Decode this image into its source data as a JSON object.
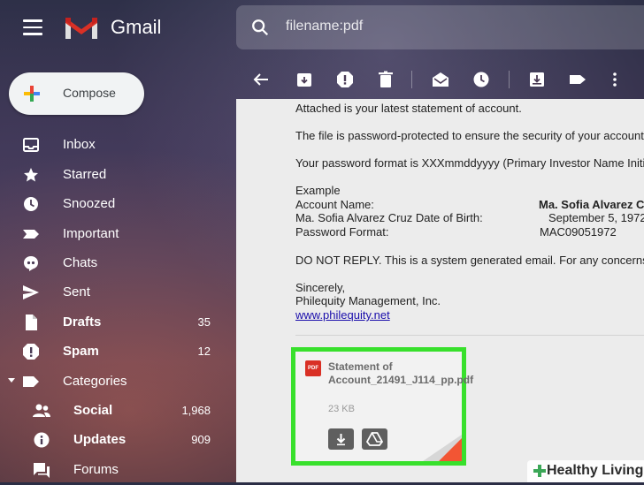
{
  "header": {
    "app_name": "Gmail",
    "search_value": "filename:pdf"
  },
  "compose": {
    "label": "Compose"
  },
  "sidebar": {
    "items": [
      {
        "label": "Inbox",
        "icon": "inbox-icon",
        "bold": false,
        "count": ""
      },
      {
        "label": "Starred",
        "icon": "star-icon",
        "bold": false,
        "count": ""
      },
      {
        "label": "Snoozed",
        "icon": "clock-icon",
        "bold": false,
        "count": ""
      },
      {
        "label": "Important",
        "icon": "important-icon",
        "bold": false,
        "count": ""
      },
      {
        "label": "Chats",
        "icon": "chat-icon",
        "bold": false,
        "count": ""
      },
      {
        "label": "Sent",
        "icon": "send-icon",
        "bold": false,
        "count": ""
      },
      {
        "label": "Drafts",
        "icon": "draft-icon",
        "bold": true,
        "count": "35"
      },
      {
        "label": "Spam",
        "icon": "spam-icon",
        "bold": true,
        "count": "12"
      },
      {
        "label": "Categories",
        "icon": "label-icon",
        "bold": false,
        "count": ""
      },
      {
        "label": "Social",
        "icon": "people-icon",
        "bold": true,
        "count": "1,968"
      },
      {
        "label": "Updates",
        "icon": "info-icon",
        "bold": true,
        "count": "909"
      },
      {
        "label": "Forums",
        "icon": "forum-icon",
        "bold": false,
        "count": ""
      }
    ]
  },
  "toolbar": {
    "buttons": [
      "back-icon",
      "archive-icon",
      "report-spam-icon",
      "delete-icon",
      "mark-unread-icon",
      "snooze-icon",
      "move-to-icon",
      "labels-icon",
      "more-icon"
    ]
  },
  "email": {
    "line1": "Attached is your latest statement of account.",
    "line2": "The file is password-protected to ensure the security of your account.",
    "line3": "Your password format is XXXmmddyyyy (Primary Investor Name Initials + Date of Birth)",
    "example_heading": "Example",
    "example": [
      {
        "key": "Account Name:",
        "value": "Ma. Sofia Alvarez Cruz"
      },
      {
        "key": "Ma. Sofia Alvarez Cruz Date of Birth:",
        "value": "September 5, 1972"
      },
      {
        "key": "Password Format:",
        "value": "MAC09051972"
      }
    ],
    "no_reply": "DO NOT REPLY. This is a system generated email. For any concerns,",
    "sign_off": "Sincerely,",
    "company": "Philequity Management, Inc.",
    "link": "www.philequity.net"
  },
  "attachment": {
    "file_type": "PDF",
    "name": "Statement of Account_21491_J114_pp.pdf",
    "size": "23 KB",
    "highlight_color": "#38e02c"
  },
  "watermark": {
    "text": "Healthy Living"
  }
}
